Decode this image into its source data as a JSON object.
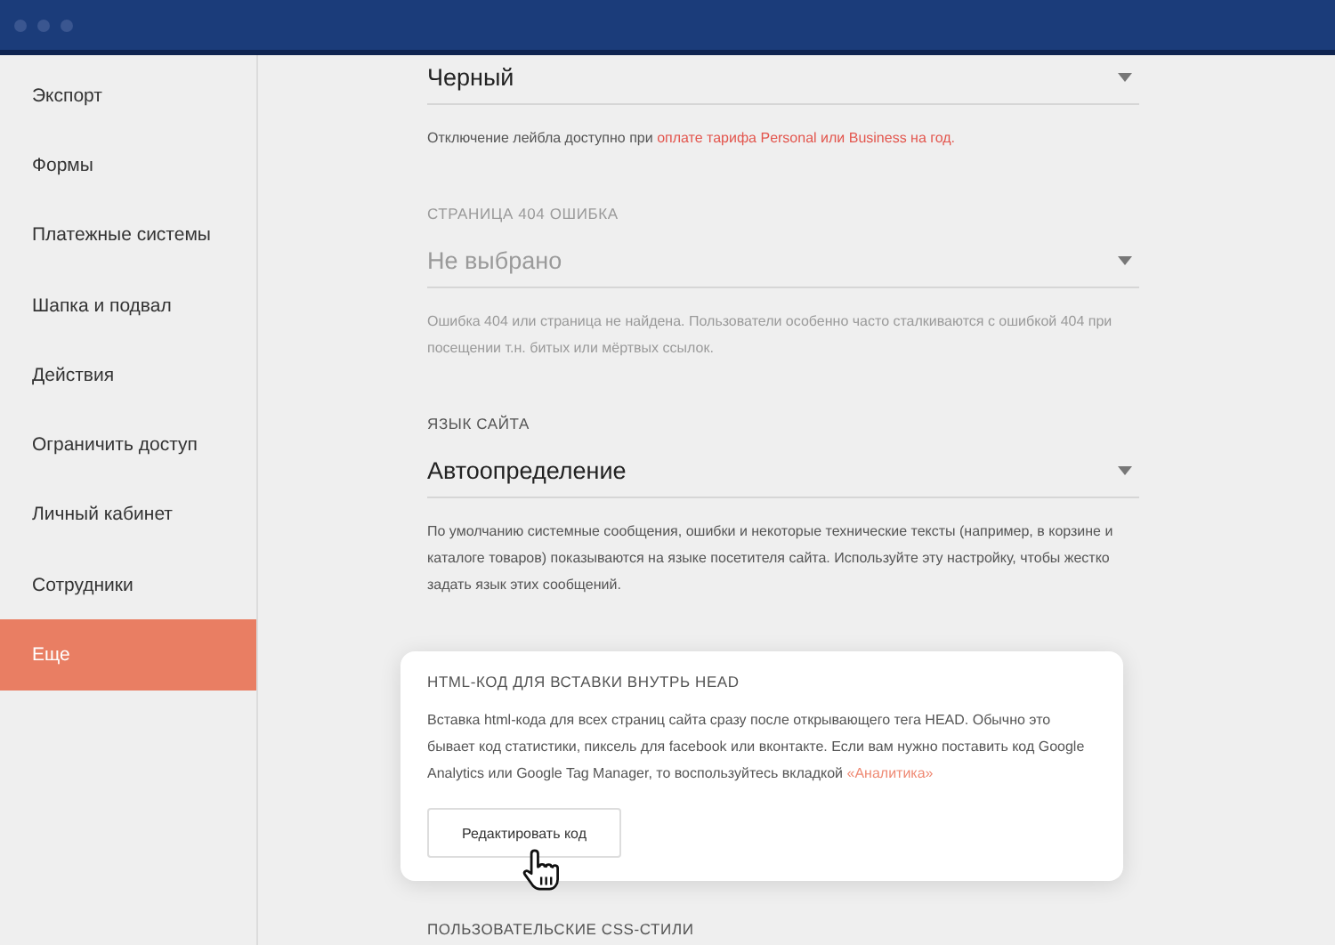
{
  "sidebar": {
    "items": [
      {
        "label": "Экспорт",
        "selected": false
      },
      {
        "label": "Формы",
        "selected": false
      },
      {
        "label": "Платежные системы",
        "selected": false
      },
      {
        "label": "Шапка и подвал",
        "selected": false
      },
      {
        "label": "Действия",
        "selected": false
      },
      {
        "label": "Ограничить доступ",
        "selected": false
      },
      {
        "label": "Личный кабинет",
        "selected": false
      },
      {
        "label": "Сотрудники",
        "selected": false
      },
      {
        "label": "Еще",
        "selected": true
      }
    ]
  },
  "sections": [
    {
      "kind": "select",
      "value": "Черный",
      "disabled": false,
      "note": "Отключение лейбла доступно при ",
      "note_link": "оплате тарифа Personal или Business на год."
    },
    {
      "kind": "select",
      "label": "СТРАНИЦА 404 ОШИБКА",
      "value": "Не выбрано",
      "disabled": true,
      "note": "Ошибка 404 или страница не найдена. Пользователи особенно часто сталкиваются с ошибкой 404 при посещении т.н. битых или мёртвых ссылок."
    },
    {
      "kind": "select",
      "label": "ЯЗЫК САЙТА",
      "value": "Автоопределение",
      "disabled": false,
      "note": "По умолчанию системные сообщения, ошибки и некоторые технические тексты (например, в корзине и каталоге товаров) показываются на языке посетителя сайта. Используйте эту настройку, чтобы жестко задать язык этих сообщений."
    },
    {
      "kind": "card",
      "label": "HTML-КОД ДЛЯ ВСТАВКИ ВНУТРЬ HEAD",
      "note": "Вставка html-кода для всех страниц сайта сразу после открывающего тега HEAD. Обычно это бывает код статистики, пиксель для facebook или вконтакте. Если вам нужно поставить код Google Analytics или Google Tag Manager, то воспользуйтесь вкладкой ",
      "note_link": "«Аналитика»",
      "button": "Редактировать код"
    },
    {
      "kind": "heading",
      "label": "ПОЛЬЗОВАТЕЛЬСКИЕ CSS-СТИЛИ"
    }
  ]
}
